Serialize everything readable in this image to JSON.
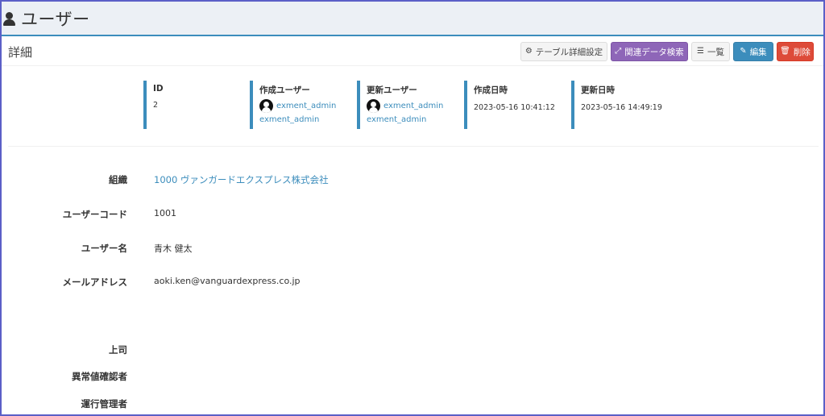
{
  "header": {
    "title": "ユーザー"
  },
  "subbar": {
    "title": "詳細"
  },
  "toolbar": {
    "table_settings": "テーブル詳細設定",
    "related_search": "関連データ検索",
    "list": "一覧",
    "edit": "編集",
    "delete": "削除"
  },
  "meta": {
    "id": {
      "label": "ID",
      "value": "2"
    },
    "created_user": {
      "label": "作成ユーザー",
      "user": "exment_admin",
      "name": "exment_admin"
    },
    "updated_user": {
      "label": "更新ユーザー",
      "user": "exment_admin",
      "name": "exment_admin"
    },
    "created_at": {
      "label": "作成日時",
      "value": "2023-05-16 10:41:12"
    },
    "updated_at": {
      "label": "更新日時",
      "value": "2023-05-16 14:49:19"
    }
  },
  "fields": [
    {
      "label": "組織",
      "value": "1000 ヴァンガードエクスプレス株式会社"
    },
    {
      "label": "ユーザーコード",
      "value": "1001"
    },
    {
      "label": "ユーザー名",
      "value": "青木 健太"
    },
    {
      "label": "メールアドレス",
      "value": "aoki.ken@vanguardexpress.co.jp"
    },
    {
      "label": "上司",
      "value": ""
    },
    {
      "label": "異常値確認者",
      "value": ""
    },
    {
      "label": "運行管理者",
      "value": ""
    }
  ],
  "colors": {
    "accent": "#3c8dbc",
    "purple": "#8e66b8",
    "danger": "#dd4b39",
    "frame": "#5b5fc7",
    "header_bg": "#ecf0f5"
  },
  "icons": [
    "user-icon",
    "gear-icon",
    "link-icon",
    "list-icon",
    "edit-icon",
    "trash-icon",
    "avatar-icon"
  ]
}
